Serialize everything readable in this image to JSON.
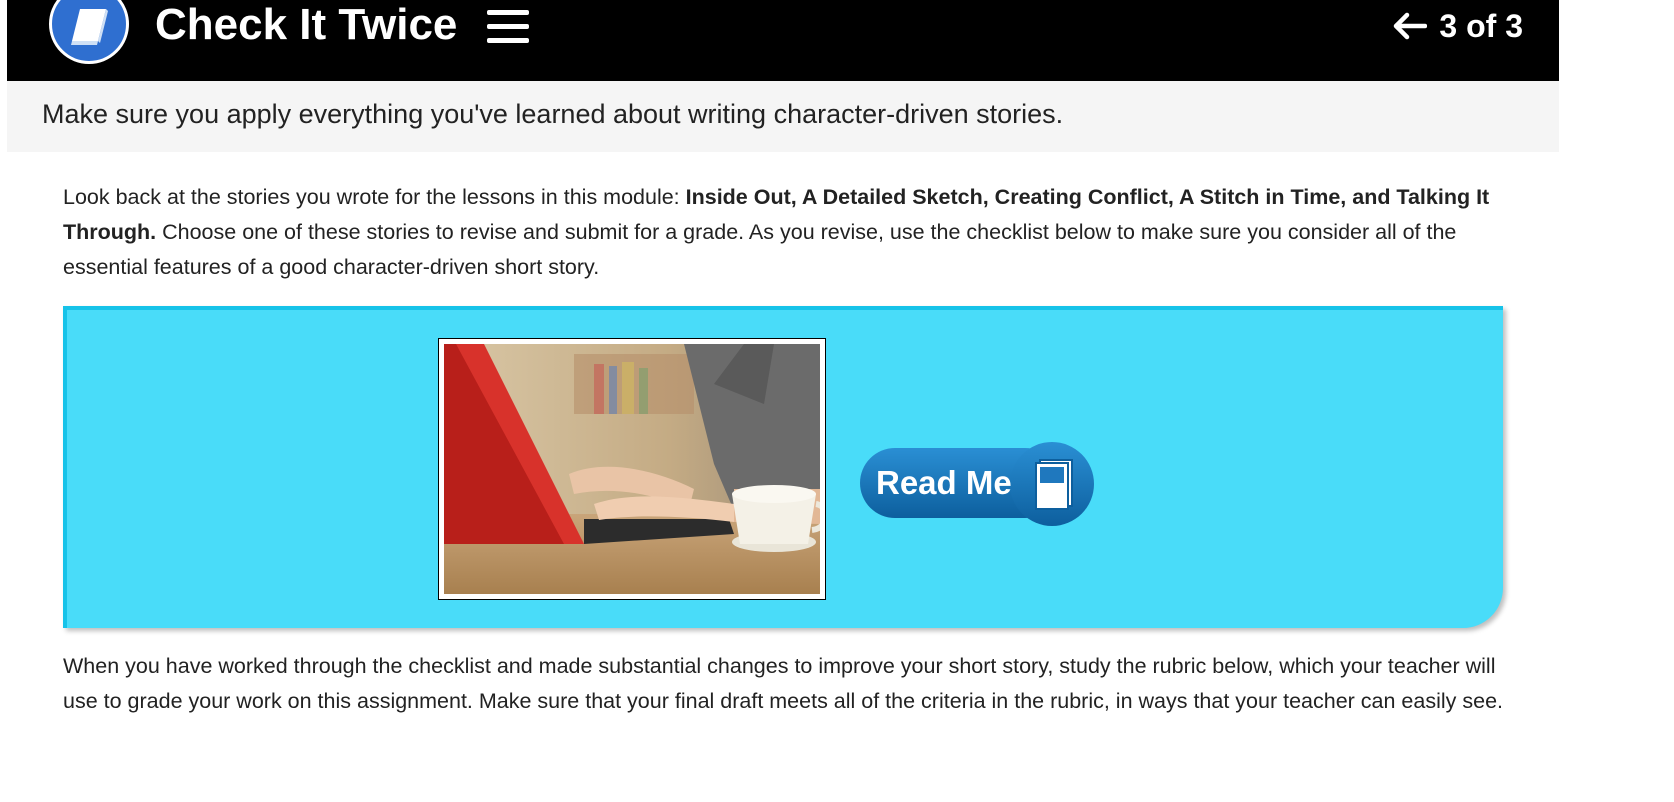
{
  "header": {
    "title": "Check It Twice",
    "pager": "3 of 3"
  },
  "subtitle": "Make sure you apply everything you've learned about writing character-driven stories.",
  "intro": {
    "lead": "Look back at the stories you wrote for the lessons in this module: ",
    "lessons": "Inside Out, A Detailed Sketch, Creating Conflict, A Stitch in Time, and Talking It Through.",
    "rest": " Choose one of these stories to revise and submit for a grade. As you revise, use the checklist below to make sure you consider all of the essential features of a good character-driven short story."
  },
  "callout": {
    "read_button_label": "Read Me"
  },
  "closing": "When you have worked through the checklist and made substantial changes to improve your short story, study the rubric below, which your teacher will use to grade your work on this assignment. Make sure that your final draft meets all of the criteria in the rubric, in ways that your teacher can easily see.",
  "colors": {
    "header_bg": "#000000",
    "callout_bg": "#49dcf9",
    "button_blue": "#1f78be"
  }
}
